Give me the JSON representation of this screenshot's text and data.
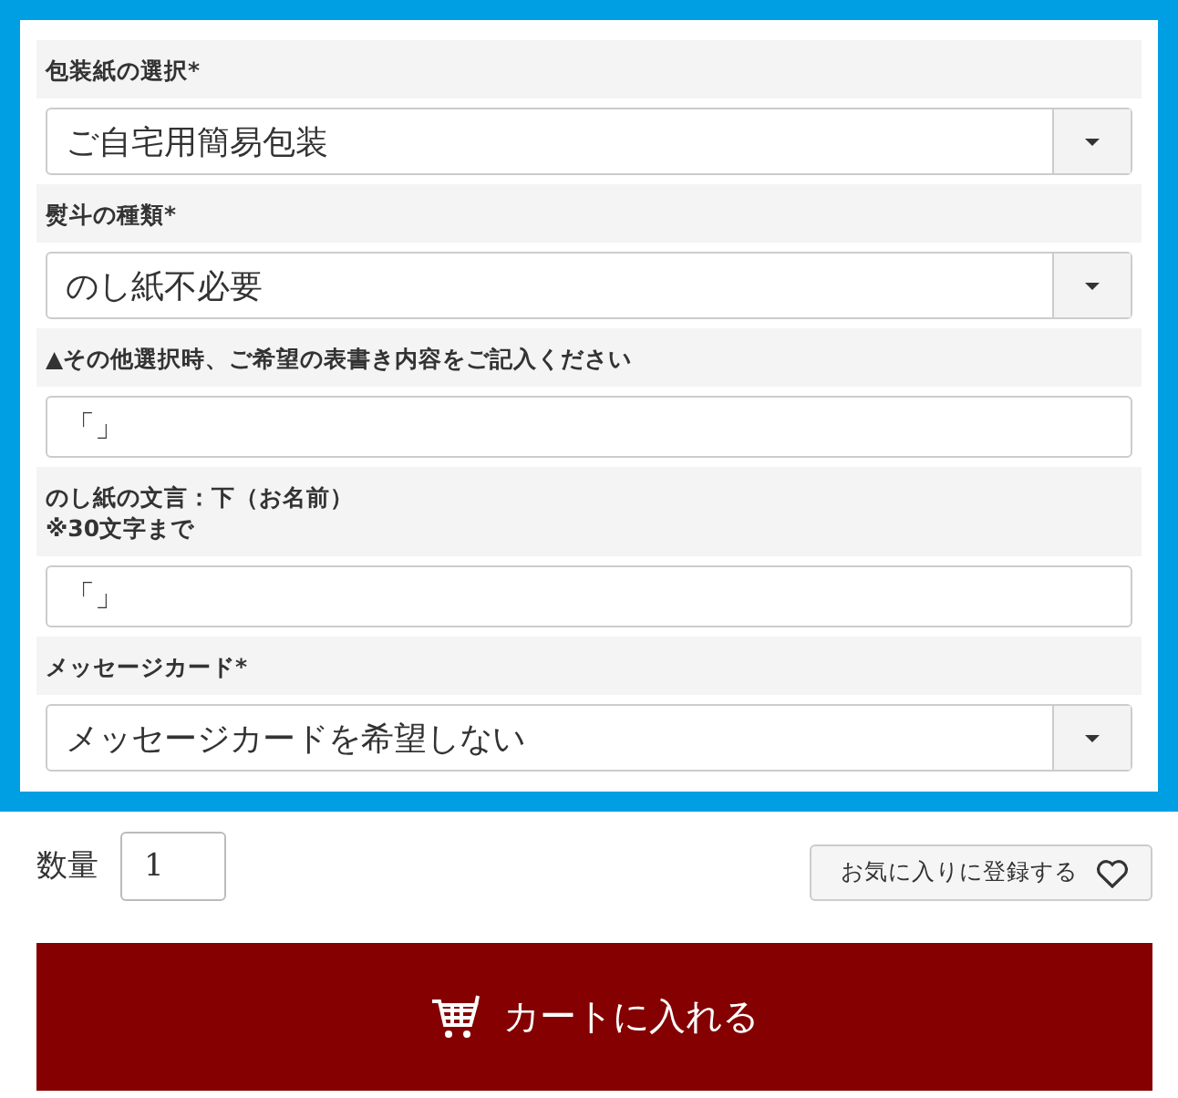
{
  "fields": [
    {
      "kind": "select",
      "label": "包装紙の選択*",
      "value": "ご自宅用簡易包装"
    },
    {
      "kind": "select",
      "label": "熨斗の種類*",
      "value": "のし紙不必要"
    },
    {
      "kind": "text",
      "label": "▲その他選択時、ご希望の表書き内容をご記入ください",
      "value": "「」"
    },
    {
      "kind": "text",
      "label": "のし紙の文言：下（お名前）\n※30文字まで",
      "value": "「」"
    },
    {
      "kind": "select",
      "label": "メッセージカード*",
      "value": "メッセージカードを希望しない"
    }
  ],
  "quantity": {
    "label": "数量",
    "value": "1"
  },
  "favorite_button": "お気に入りに登録する",
  "cart_button": "カートに入れる"
}
